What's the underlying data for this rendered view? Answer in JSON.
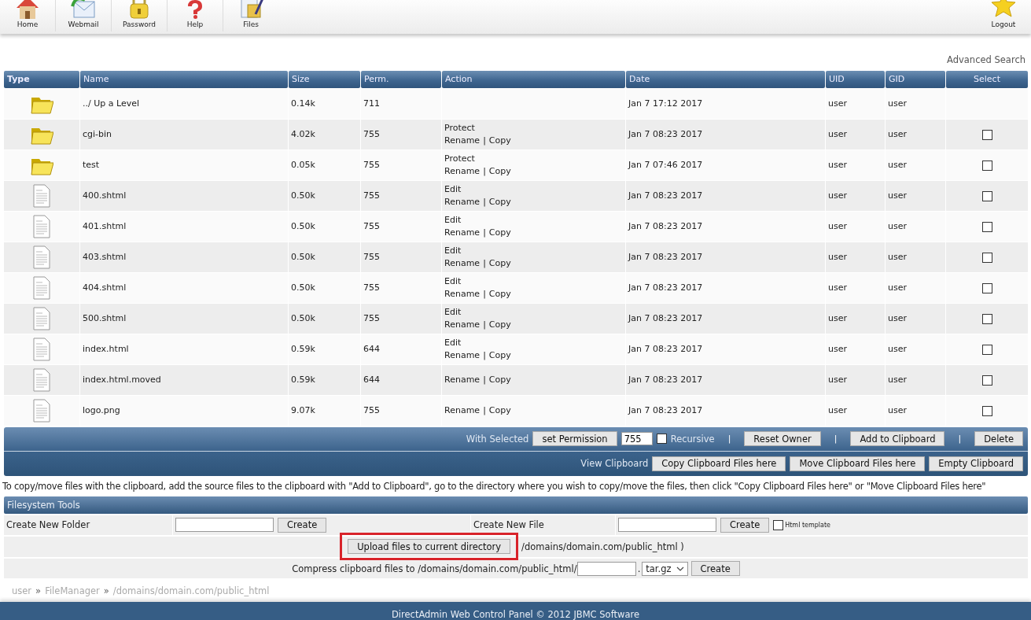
{
  "nav": [
    {
      "label": "Home",
      "kind": "house"
    },
    {
      "label": "Webmail",
      "kind": "mail"
    },
    {
      "label": "Password",
      "kind": "lock"
    },
    {
      "label": "Help",
      "kind": "question"
    },
    {
      "label": "Files",
      "kind": "files"
    }
  ],
  "logout": {
    "label": "Logout",
    "kind": "star"
  },
  "advanced_search": "Advanced Search",
  "table": {
    "columns": [
      "Type",
      "Name",
      "Size",
      "Perm.",
      "Action",
      "Date",
      "UID",
      "GID",
      "Select"
    ],
    "rows": [
      {
        "kind": "folder",
        "name": "../ Up a Level",
        "size": "0.14k",
        "perm": "711",
        "actions": [],
        "date": "Jan 7 17:12 2017",
        "uid": "user",
        "gid": "user"
      },
      {
        "kind": "folder",
        "name": "cgi-bin",
        "size": "4.02k",
        "perm": "755",
        "actions": [
          [
            "Protect"
          ],
          [
            "Rename",
            "|",
            "Copy"
          ]
        ],
        "date": "Jan 7 08:23 2017",
        "uid": "user",
        "gid": "user",
        "checked": false
      },
      {
        "kind": "folder",
        "name": "test",
        "size": "0.05k",
        "perm": "755",
        "actions": [
          [
            "Protect"
          ],
          [
            "Rename",
            "|",
            "Copy"
          ]
        ],
        "date": "Jan 7 07:46 2017",
        "uid": "user",
        "gid": "user",
        "checked": false
      },
      {
        "kind": "file",
        "name": "400.shtml",
        "size": "0.50k",
        "perm": "755",
        "actions": [
          [
            "Edit"
          ],
          [
            "Rename",
            "|",
            "Copy"
          ]
        ],
        "date": "Jan 7 08:23 2017",
        "uid": "user",
        "gid": "user",
        "checked": false
      },
      {
        "kind": "file",
        "name": "401.shtml",
        "size": "0.50k",
        "perm": "755",
        "actions": [
          [
            "Edit"
          ],
          [
            "Rename",
            "|",
            "Copy"
          ]
        ],
        "date": "Jan 7 08:23 2017",
        "uid": "user",
        "gid": "user",
        "checked": false
      },
      {
        "kind": "file",
        "name": "403.shtml",
        "size": "0.50k",
        "perm": "755",
        "actions": [
          [
            "Edit"
          ],
          [
            "Rename",
            "|",
            "Copy"
          ]
        ],
        "date": "Jan 7 08:23 2017",
        "uid": "user",
        "gid": "user",
        "checked": false
      },
      {
        "kind": "file",
        "name": "404.shtml",
        "size": "0.50k",
        "perm": "755",
        "actions": [
          [
            "Edit"
          ],
          [
            "Rename",
            "|",
            "Copy"
          ]
        ],
        "date": "Jan 7 08:23 2017",
        "uid": "user",
        "gid": "user",
        "checked": false
      },
      {
        "kind": "file",
        "name": "500.shtml",
        "size": "0.50k",
        "perm": "755",
        "actions": [
          [
            "Edit"
          ],
          [
            "Rename",
            "|",
            "Copy"
          ]
        ],
        "date": "Jan 7 08:23 2017",
        "uid": "user",
        "gid": "user",
        "checked": false
      },
      {
        "kind": "file",
        "name": "index.html",
        "size": "0.59k",
        "perm": "644",
        "actions": [
          [
            "Edit"
          ],
          [
            "Rename",
            "|",
            "Copy"
          ]
        ],
        "date": "Jan 7 08:23 2017",
        "uid": "user",
        "gid": "user",
        "checked": false
      },
      {
        "kind": "file",
        "name": "index.html.moved",
        "size": "0.59k",
        "perm": "644",
        "actions": [
          [
            "Rename",
            "|",
            "Copy"
          ]
        ],
        "date": "Jan 7 08:23 2017",
        "uid": "user",
        "gid": "user",
        "checked": false
      },
      {
        "kind": "file",
        "name": "logo.png",
        "size": "9.07k",
        "perm": "755",
        "actions": [
          [
            "Rename",
            "|",
            "Copy"
          ]
        ],
        "date": "Jan 7 08:23 2017",
        "uid": "user",
        "gid": "user",
        "checked": false
      }
    ]
  },
  "bulk_actions": [
    [
      {
        "kind": "label",
        "text": "With Selected"
      },
      {
        "kind": "button",
        "text": "set Permission"
      },
      {
        "kind": "input",
        "value": "755"
      },
      {
        "kind": "checkbox",
        "text": "Recursive",
        "checked": false
      },
      {
        "kind": "separator",
        "text": "|"
      },
      {
        "kind": "button",
        "text": "Reset Owner"
      },
      {
        "kind": "separator",
        "text": "|"
      },
      {
        "kind": "button",
        "text": "Add to Clipboard"
      },
      {
        "kind": "separator",
        "text": "|"
      },
      {
        "kind": "button",
        "text": "Delete"
      }
    ],
    [
      {
        "kind": "label",
        "text": "View Clipboard"
      },
      {
        "kind": "button",
        "text": "Copy Clipboard Files here"
      },
      {
        "kind": "button",
        "text": "Move Clipboard Files here"
      },
      {
        "kind": "button",
        "text": "Empty Clipboard"
      }
    ]
  ],
  "clipboard_note": "To copy/move files with the clipboard, add the source files to the clipboard with \"Add to Clipboard\", go to the directory where you wish to copy/move the files, then click \"Copy Clipboard Files here\" or \"Move Clipboard Files here\"",
  "filesystem_tools": {
    "title": "Filesystem Tools",
    "create_folder": {
      "label": "Create New Folder",
      "button": "Create"
    },
    "create_file": {
      "label": "Create New File",
      "button": "Create",
      "template_label": "Html template",
      "template_checked": false
    },
    "upload": {
      "button": "Upload files to current directory",
      "highlighted": true,
      "path": "/domains/domain.com/public_html )"
    },
    "compress": {
      "label": "Compress clipboard files to /domains/domain.com/public_html/",
      "dot": ".",
      "format": "tar.gz",
      "button": "Create"
    }
  },
  "breadcrumb": [
    "user",
    "»",
    "FileManager",
    "»",
    "/domains/domain.com/public_html"
  ],
  "footer": "DirectAdmin Web Control Panel © 2012 JBMC Software"
}
